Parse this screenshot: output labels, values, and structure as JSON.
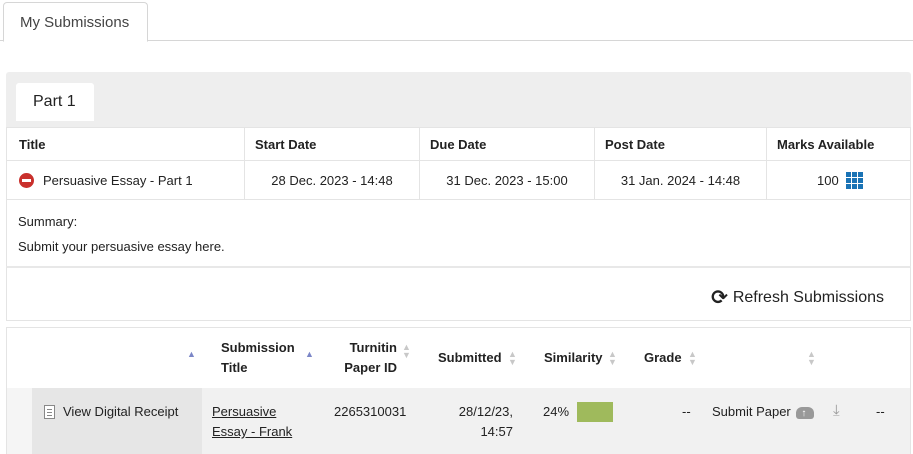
{
  "top_tab": {
    "label": "My Submissions"
  },
  "part_tab": {
    "label": "Part 1"
  },
  "assignment_table": {
    "headers": [
      "Title",
      "Start Date",
      "Due Date",
      "Post Date",
      "Marks Available"
    ],
    "row": {
      "title": "Persuasive Essay - Part 1",
      "start_date": "28 Dec. 2023 - 14:48",
      "due_date": "31 Dec. 2023 - 15:00",
      "post_date": "31 Jan. 2024 - 14:48",
      "marks": "100"
    },
    "summary_label": "Summary:",
    "summary_text": "Submit your persuasive essay here."
  },
  "refresh": {
    "label": "Refresh Submissions",
    "icon": "refresh-icon"
  },
  "submissions": {
    "headers": {
      "submission_title_1": "Submission",
      "submission_title_2": "Title",
      "paper_id_1": "Turnitin",
      "paper_id_2": "Paper ID",
      "submitted": "Submitted",
      "similarity": "Similarity",
      "grade": "Grade"
    },
    "row": {
      "receipt": "View Digital Receipt",
      "title_line1": "Persuasive",
      "title_line2": "Essay - Frank",
      "paper_id": "2265310031",
      "submitted_line1": "28/12/23,",
      "submitted_line2": "14:57",
      "similarity": "24%",
      "similarity_color": "#9fba5c",
      "grade": "--",
      "submit_paper": "Submit Paper",
      "last": "--"
    }
  }
}
